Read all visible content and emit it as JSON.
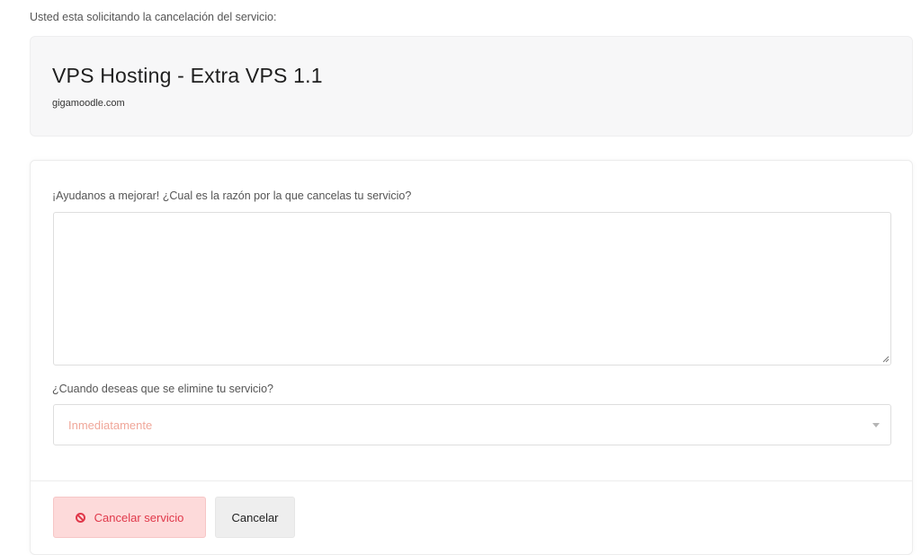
{
  "intro_text": "Usted esta solicitando la cancelación del servicio:",
  "service": {
    "title": "VPS Hosting - Extra VPS 1.1",
    "domain": "gigamoodle.com"
  },
  "form": {
    "reason_label": "¡Ayudanos a mejorar! ¿Cual es la razón por la que cancelas tu servicio?",
    "reason_value": "",
    "when_label": "¿Cuando deseas que se elimine tu servicio?",
    "when_selected": "Inmediatamente"
  },
  "actions": {
    "cancel_service_label": "Cancelar servicio",
    "cancel_label": "Cancelar"
  },
  "colors": {
    "danger": "#e0384a",
    "danger_bg": "#fddada",
    "select_value": "#f0a79a"
  },
  "icons": {
    "cancel_service": "ban-icon",
    "select": "chevron-down-icon"
  }
}
